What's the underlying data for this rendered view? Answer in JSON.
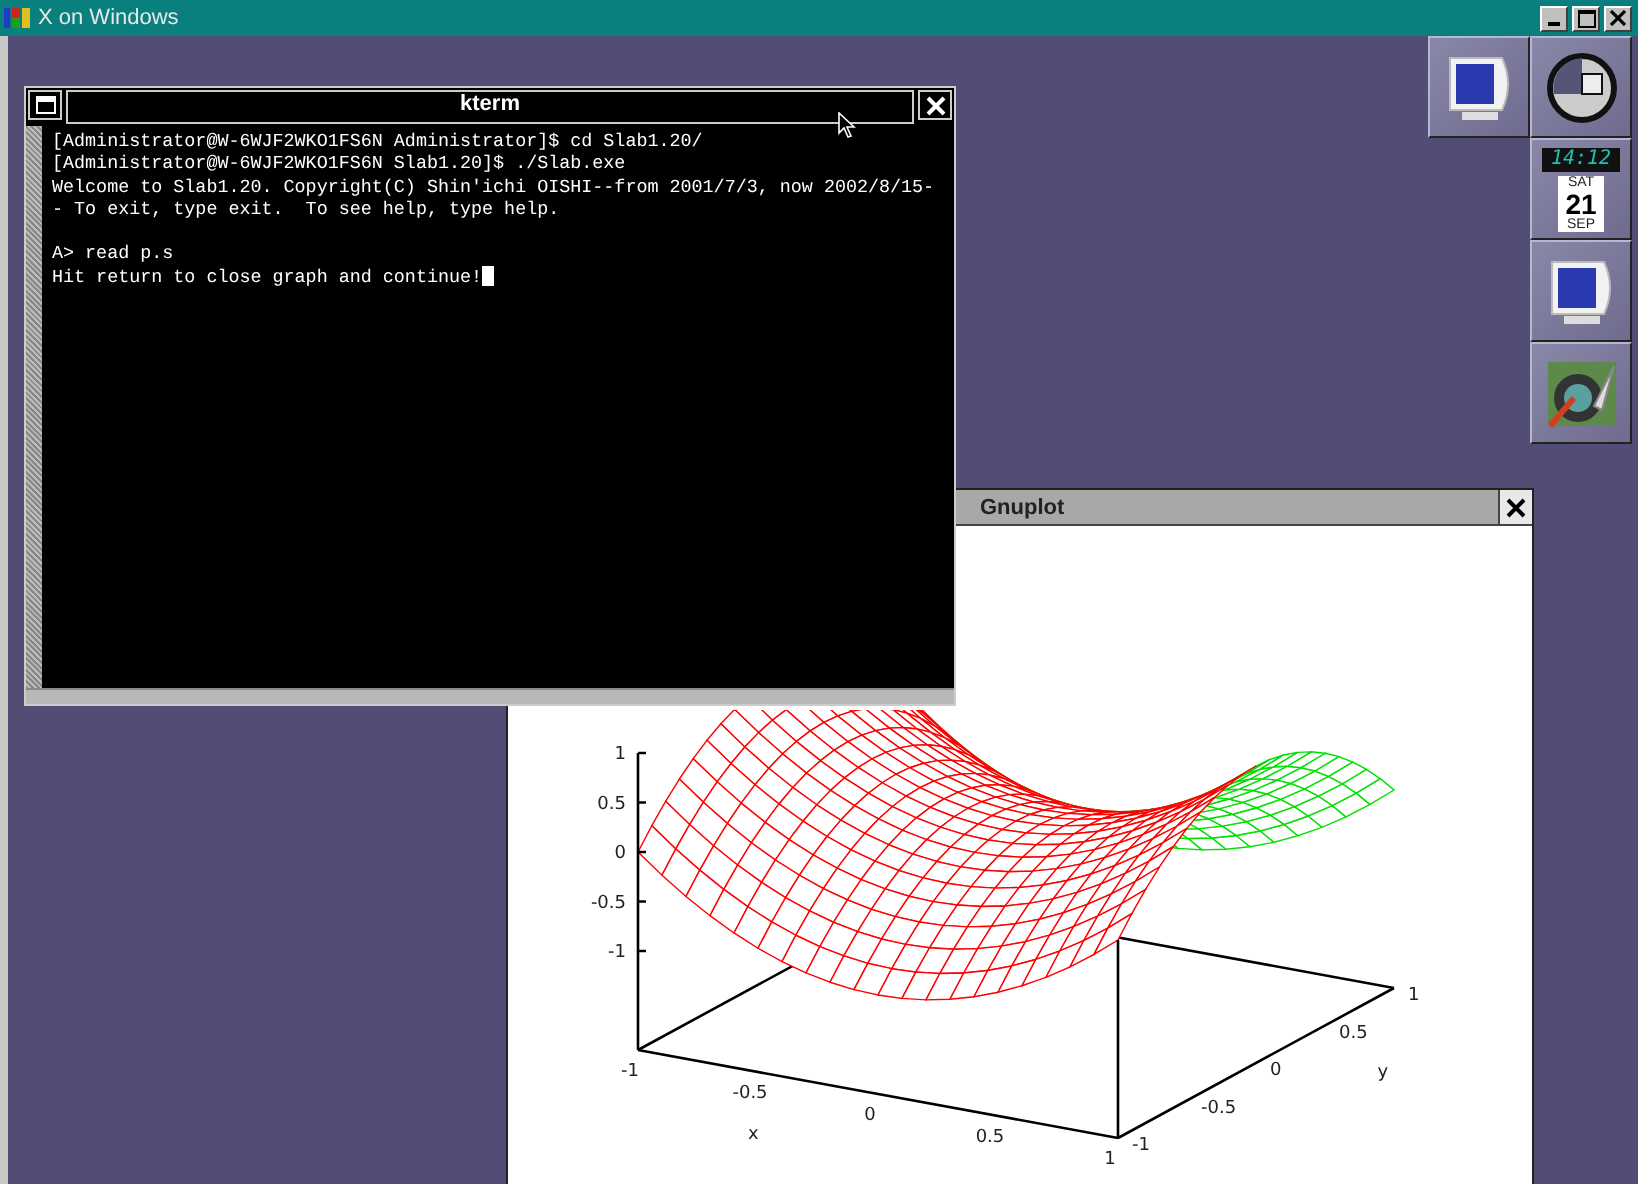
{
  "window": {
    "title": "X on Windows"
  },
  "terminal": {
    "title": "kterm",
    "cursor": true,
    "blocks": [
      [
        "[Administrator@W-6WJF2WKO1FS6N Administrator]$ cd Slab1.20/",
        "[Administrator@W-6WJF2WKO1FS6N Slab1.20]$ ./Slab.exe",
        "Welcome to Slab1.20. Copyright(C) Shin'ichi OISHI--from 2001/7/3, now 2002/8/15-",
        "- To exit, type exit.  To see help, type help."
      ],
      [
        "A> read p.s",
        "Hit return to close graph and continue!"
      ]
    ]
  },
  "plot_window": {
    "title": "Gnuplot",
    "z_ticks": [
      "1",
      "0.5",
      "0",
      "-0.5",
      "-1"
    ],
    "x_ticks": [
      "-1",
      "-0.5",
      "0",
      "0.5",
      "1"
    ],
    "x_label": "x",
    "y_ticks": [
      "-1",
      "-0.5",
      "0",
      "0.5",
      "1"
    ],
    "y_label": "y"
  },
  "dock": {
    "clock": "14:12",
    "calendar": {
      "weekday": "SAT",
      "day": "21",
      "month": "SEP"
    }
  }
}
